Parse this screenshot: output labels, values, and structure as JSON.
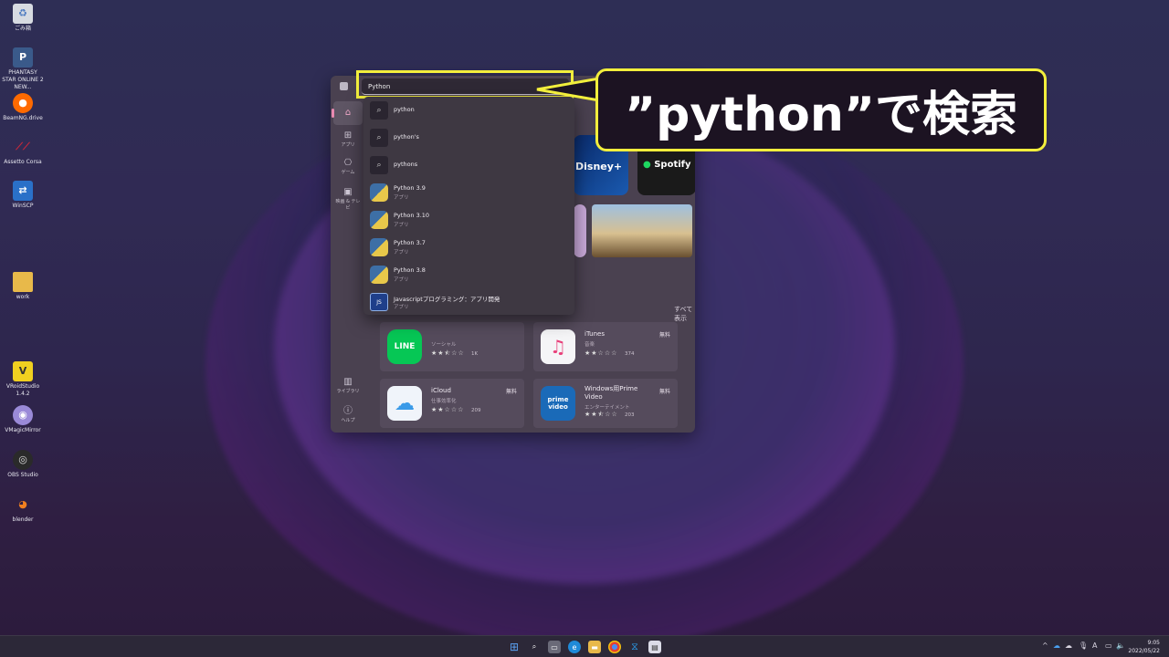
{
  "desktop": {
    "icons": [
      {
        "label": "ごみ箱"
      },
      {
        "label": "PHANTASY STAR ONLINE 2 NEW..."
      },
      {
        "label": "BeamNG.drive"
      },
      {
        "label": "Assetto Corsa"
      },
      {
        "label": "WinSCP"
      },
      {
        "label": "work"
      },
      {
        "label": "VRoidStudio 1.4.2"
      },
      {
        "label": "VMagicMirror"
      },
      {
        "label": "OBS Studio"
      },
      {
        "label": "blender"
      }
    ]
  },
  "store": {
    "window_controls": {
      "minimize": "—",
      "maximize": "☐",
      "close": "✕"
    },
    "sidebar": {
      "apps": "アプリ",
      "games": "ゲーム",
      "movies": "映画 & テレビ",
      "library": "ライブラリ",
      "help": "ヘルプ"
    },
    "featured": {
      "disney": "Disney+",
      "spotify": "Spotify"
    },
    "see_all": "すべて表示",
    "cards": [
      {
        "name": "",
        "icon_text": "LINE",
        "category": "ソーシャル",
        "stars": "★★⯪☆☆",
        "count": "1K",
        "price": ""
      },
      {
        "name": "iTunes",
        "icon_text": "♫",
        "category": "音楽",
        "stars": "★★☆☆☆",
        "count": "374",
        "price": "無料"
      },
      {
        "name": "iCloud",
        "icon_text": "☁",
        "category": "仕事効率化",
        "stars": "★★☆☆☆",
        "count": "209",
        "price": "無料"
      },
      {
        "name": "Windows用Prime Video",
        "icon_text": "prime video",
        "category": "エンターテイメント",
        "stars": "★★⯪☆☆",
        "count": "203",
        "price": "無料"
      }
    ]
  },
  "search": {
    "value": "Python",
    "suggestions": [
      {
        "label": "python",
        "sub": "",
        "kind": "query"
      },
      {
        "label": "python's",
        "sub": "",
        "kind": "query"
      },
      {
        "label": "pythons",
        "sub": "",
        "kind": "query"
      },
      {
        "label": "Python 3.9",
        "sub": "アプリ",
        "kind": "app"
      },
      {
        "label": "Python 3.10",
        "sub": "アプリ",
        "kind": "app"
      },
      {
        "label": "Python 3.7",
        "sub": "アプリ",
        "kind": "app"
      },
      {
        "label": "Python 3.8",
        "sub": "アプリ",
        "kind": "app"
      },
      {
        "label": "Javascriptプログラミング：アプリ開発",
        "sub": "アプリ",
        "kind": "js"
      }
    ]
  },
  "callout": {
    "text": "”python”で検索"
  },
  "taskbar": {
    "clock_time": "9:05",
    "clock_date": "2022/05/22",
    "ime": "A"
  },
  "colors": {
    "highlight": "#f2ee3c",
    "callout_bg": "#1c1322",
    "accent": "#e889b0"
  }
}
